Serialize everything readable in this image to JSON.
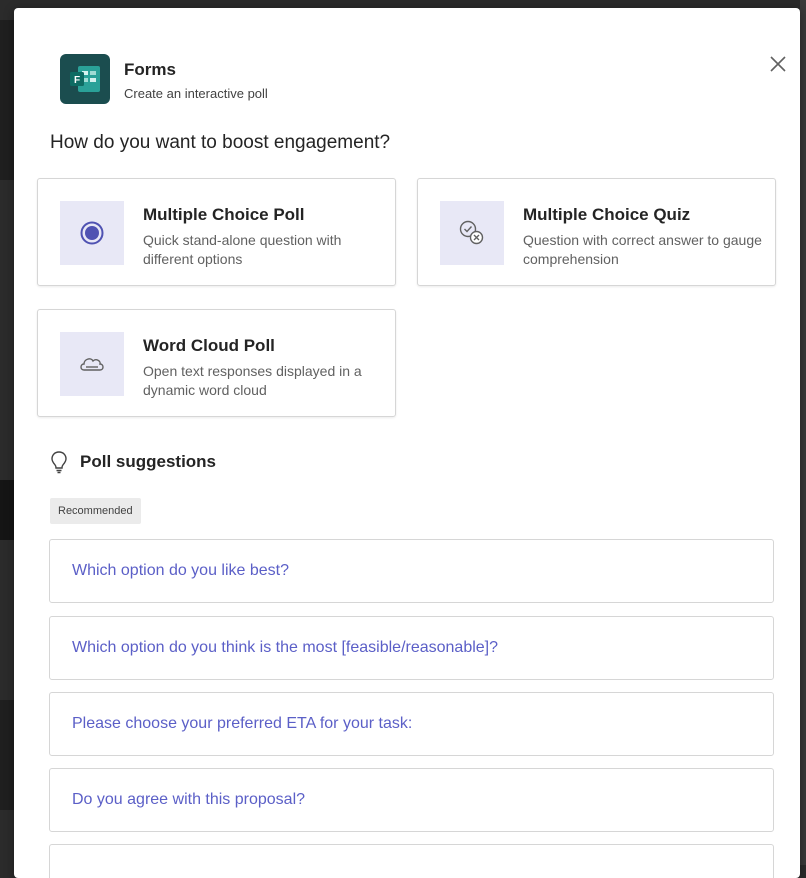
{
  "app": {
    "name": "Forms",
    "subtitle": "Create an interactive poll",
    "icon": "forms-app-icon",
    "brand_color": "#1b4d4f"
  },
  "prompt": "How do you want to boost engagement?",
  "options": [
    {
      "title": "Multiple Choice Poll",
      "description": "Quick stand-alone question with different options",
      "icon": "radio-button-icon"
    },
    {
      "title": "Multiple Choice Quiz",
      "description": "Question with correct answer to gauge comprehension",
      "icon": "quiz-check-icon"
    },
    {
      "title": "Word Cloud Poll",
      "description": "Open text responses displayed in a dynamic word cloud",
      "icon": "cloud-icon"
    }
  ],
  "suggestions_section": {
    "title": "Poll suggestions",
    "icon": "lightbulb-icon",
    "badge": "Recommended",
    "items": [
      "Which option do you like best?",
      "Which option do you think is the most [feasible/reasonable]?",
      "Please choose your preferred ETA for your task:",
      "Do you agree with this proposal?"
    ]
  },
  "colors": {
    "accent": "#5b5fc7",
    "icon_tile": "#e8e8f6"
  }
}
